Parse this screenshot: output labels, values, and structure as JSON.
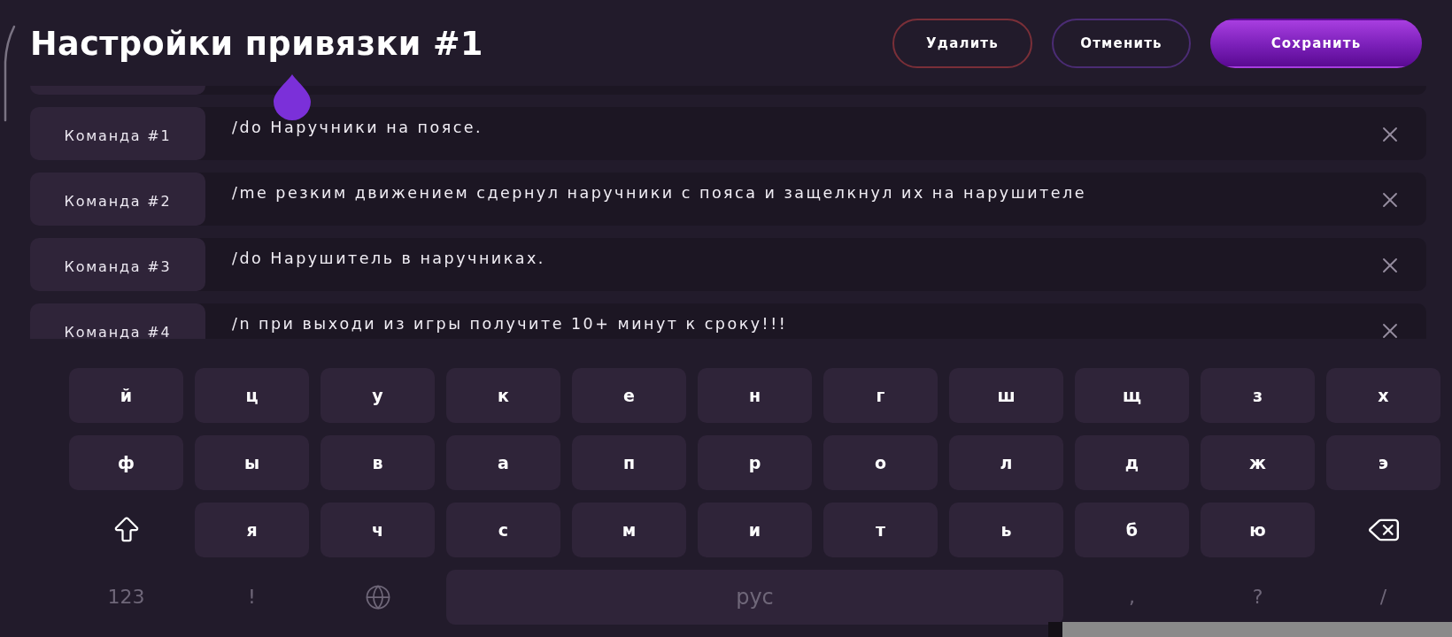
{
  "header": {
    "title": "Настройки привязки #1",
    "buttons": [
      {
        "label": "Удалить",
        "kind": "danger"
      },
      {
        "label": "Отменить",
        "kind": "secondary"
      },
      {
        "label": "Сохранить",
        "kind": "primary"
      }
    ]
  },
  "commands": [
    {
      "label": "Команда #1",
      "text": "/do Наручники на поясе."
    },
    {
      "label": "Команда #2",
      "text": "/me резким движением сдернул наручники с пояса и защелкнул их на нарушителе"
    },
    {
      "label": "Команда #3",
      "text": "/do Нарушитель в наручниках."
    },
    {
      "label": "Команда #4",
      "text": "/n при выходи из игры получите 10+ минут к сроку!!!"
    }
  ],
  "keyboard": {
    "rows": [
      [
        {
          "kind": "letter",
          "label": "й"
        },
        {
          "kind": "letter",
          "label": "ц"
        },
        {
          "kind": "letter",
          "label": "у"
        },
        {
          "kind": "letter",
          "label": "к"
        },
        {
          "kind": "letter",
          "label": "е"
        },
        {
          "kind": "letter",
          "label": "н"
        },
        {
          "kind": "letter",
          "label": "г"
        },
        {
          "kind": "letter",
          "label": "ш"
        },
        {
          "kind": "letter",
          "label": "щ"
        },
        {
          "kind": "letter",
          "label": "з"
        },
        {
          "kind": "letter",
          "label": "х"
        }
      ],
      [
        {
          "kind": "letter",
          "label": "ф"
        },
        {
          "kind": "letter",
          "label": "ы"
        },
        {
          "kind": "letter",
          "label": "в"
        },
        {
          "kind": "letter",
          "label": "а"
        },
        {
          "kind": "letter",
          "label": "п"
        },
        {
          "kind": "letter",
          "label": "р"
        },
        {
          "kind": "letter",
          "label": "о"
        },
        {
          "kind": "letter",
          "label": "л"
        },
        {
          "kind": "letter",
          "label": "д"
        },
        {
          "kind": "letter",
          "label": "ж"
        },
        {
          "kind": "letter",
          "label": "э"
        }
      ],
      [
        {
          "kind": "shift"
        },
        {
          "kind": "letter",
          "label": "я"
        },
        {
          "kind": "letter",
          "label": "ч"
        },
        {
          "kind": "letter",
          "label": "с"
        },
        {
          "kind": "letter",
          "label": "м"
        },
        {
          "kind": "letter",
          "label": "и"
        },
        {
          "kind": "letter",
          "label": "т"
        },
        {
          "kind": "letter",
          "label": "ь"
        },
        {
          "kind": "letter",
          "label": "б"
        },
        {
          "kind": "letter",
          "label": "ю"
        },
        {
          "kind": "backspace"
        }
      ]
    ],
    "bottom_row": [
      {
        "kind": "mode",
        "label": "123"
      },
      {
        "kind": "symbol",
        "label": "!"
      },
      {
        "kind": "globe"
      },
      {
        "kind": "space",
        "label": "рус"
      },
      {
        "kind": "symbol",
        "label": ","
      },
      {
        "kind": "symbol",
        "label": "?"
      },
      {
        "kind": "symbol",
        "label": "/"
      }
    ]
  }
}
